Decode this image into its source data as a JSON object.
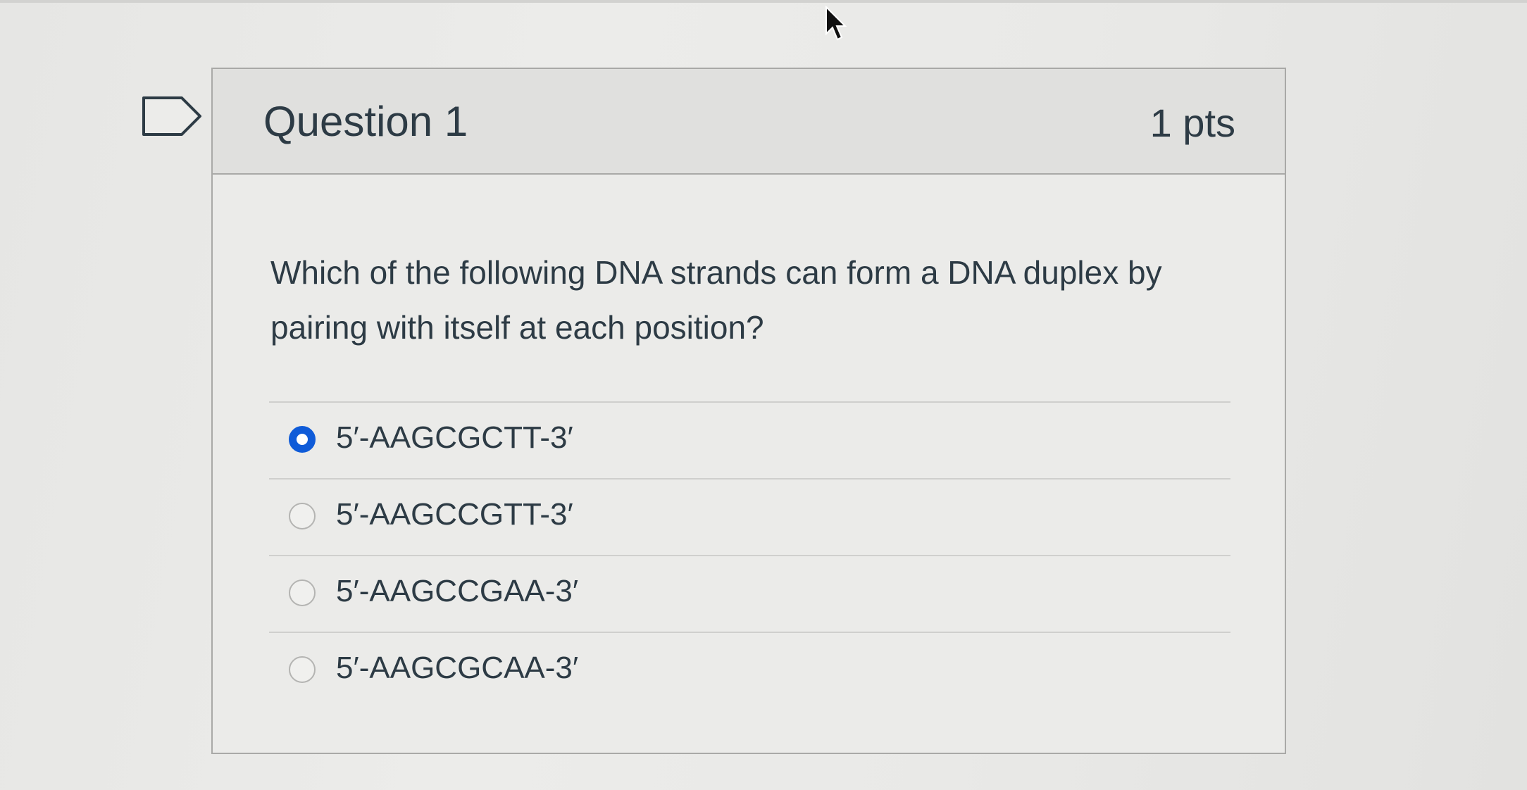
{
  "question": {
    "title": "Question 1",
    "points": "1 pts",
    "text": "Which of the following DNA strands can form a DNA duplex by pairing with itself at each position?"
  },
  "answers": [
    {
      "label": "5′-AAGCGCTT-3′",
      "selected": true
    },
    {
      "label": "5′-AAGCCGTT-3′",
      "selected": false
    },
    {
      "label": "5′-AAGCCGAA-3′",
      "selected": false
    },
    {
      "label": "5′-AAGCGCAA-3′",
      "selected": false
    }
  ],
  "icons": {
    "flag": "flag-icon",
    "cursor": "mouse-cursor-icon"
  },
  "colors": {
    "accent": "#0f5bd8",
    "text": "#2d3b45",
    "border": "#a9a9a7"
  }
}
